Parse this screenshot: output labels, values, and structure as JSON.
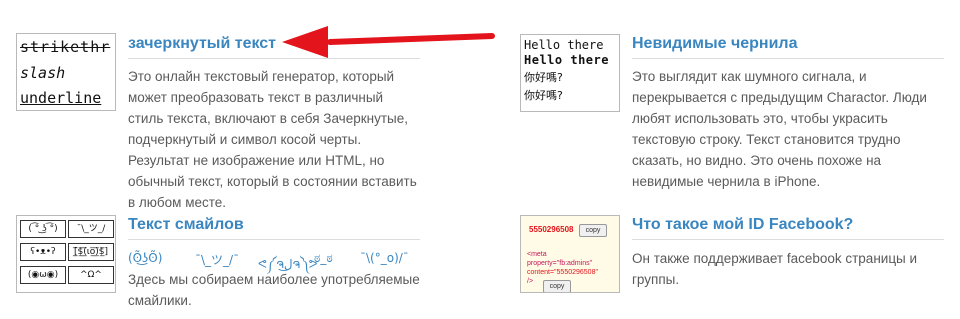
{
  "cards": [
    {
      "title": "зачеркнутый текст",
      "description": "Это онлайн текстовый генератор, который может преобразовать текст в различный стиль текста, включают в себя Зачеркнутые, подчеркнутый и символ косой черты. Результат не изображение или HTML, но обычный текст, который в состоянии вставить в любом месте.",
      "thumb": {
        "line1": "strikethr",
        "line2": "slash",
        "line3": "underline"
      }
    },
    {
      "title": "Невидимые чернила",
      "description": "Это выглядит как шумного сигнала, и перекрывается с предыдущим Charactor. Люди любят использовать это, чтобы украсить текстовую строку. Текст становится трудно сказать, но видно. Это очень похоже на невидимые чернила в iPhone.",
      "thumb": {
        "line1": "Hello there",
        "line2": "Hello there",
        "line3": "你好嗎?",
        "line4": "你好嗎?"
      }
    },
    {
      "title": "Текст смайлов",
      "description": "Здесь мы собираем наиболее употребляемые смайлики.",
      "emoticons": [
        "(ʘ̃͜ʖʘ̃)",
        "¯\\_ツ_/¯",
        "ᕙ༼ຈل͜ຈ༽ᕗ",
        "ಠ_ಠ",
        "¯\\(°_o)/¯"
      ],
      "thumb": {
        "cells": [
          "( ͡° ͜ʖ ͡°)",
          "¯\\_ツ_/",
          "ʕ•ᴥ•ʔ",
          "[̲̅$̲̅(̲̅ιο̲̅)̲̅$̲̅]",
          "(◉ω◉)",
          "^Ω^"
        ]
      }
    },
    {
      "title": "Что такое мой ID Facebook?",
      "description": "Он также поддерживает facebook страницы и группы.",
      "thumb": {
        "id": "5550296508",
        "copy": "copy",
        "meta_line1": "<meta",
        "meta_line2": "property=\"fb:admins\"",
        "meta_line3": "content=\"5550296508\"",
        "meta_line4": "/>"
      }
    }
  ],
  "colors": {
    "title": "#3a86c0",
    "arrow": "#e3141b",
    "text": "#5a5a5a"
  },
  "icons": {
    "arrow": "red-arrow-icon"
  }
}
